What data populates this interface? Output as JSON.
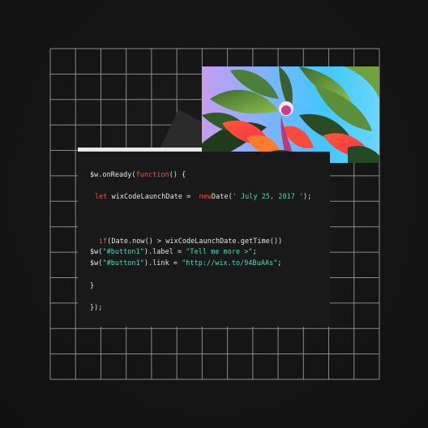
{
  "code_lines": [
    {
      "parts": [
        "$w.onReady(",
        "function",
        "() {"
      ]
    },
    {
      "parts": [
        "let",
        " wixCodeLaunchDate =  ",
        "new",
        "Date(",
        "' July 25, 2017 '",
        ");"
      ]
    },
    {
      "parts": [
        "if",
        "(Date.now() > wixCodeLaunchDate.getTime())"
      ]
    },
    {
      "parts": [
        "$w(",
        "\"#button1\"",
        ").label = ",
        "\"Tell me more >\"",
        ";"
      ]
    },
    {
      "parts": [
        "$w(",
        "\"#button1\"",
        ").link = ",
        "\"http://wix.to/94BuAAs\"",
        ";"
      ]
    },
    {
      "parts": [
        "}"
      ]
    },
    {
      "parts": [
        "});"
      ]
    }
  ],
  "colors": {
    "keyword": "#ff4f3f",
    "string": "#4fd9b5",
    "text": "#e6e6e6",
    "panel": "#191919",
    "grid_line": "#8a8a8a"
  },
  "image": {
    "semantic": "tropical-leaves-photo"
  }
}
